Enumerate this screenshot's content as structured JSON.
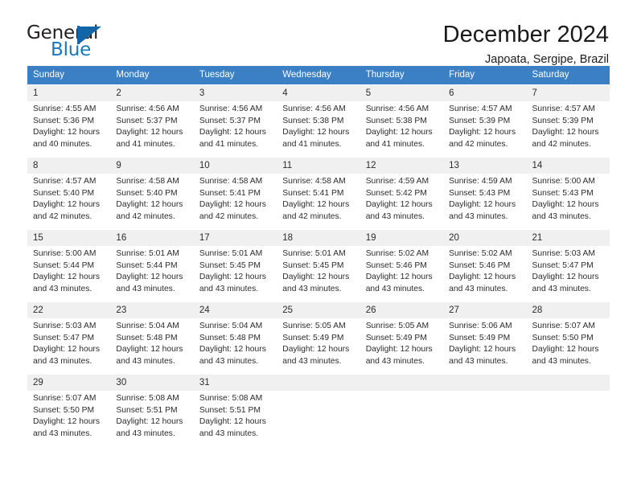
{
  "brand": {
    "name_part1": "General",
    "name_part2": "Blue",
    "sail_icon": "triangle-sail-icon",
    "accent_color": "#1878bd"
  },
  "header": {
    "title": "December 2024",
    "subtitle": "Japoata, Sergipe, Brazil"
  },
  "theme": {
    "header_row_bg": "#3b7fc4",
    "daynum_bg": "#f0f0f0",
    "separator_color": "#4683c6",
    "text_color": "#2b2b2b"
  },
  "weekdays": [
    "Sunday",
    "Monday",
    "Tuesday",
    "Wednesday",
    "Thursday",
    "Friday",
    "Saturday"
  ],
  "labels": {
    "sunrise": "Sunrise:",
    "sunset": "Sunset:",
    "daylight": "Daylight:"
  },
  "weeks": [
    [
      {
        "day": "1",
        "sunrise": "Sunrise: 4:55 AM",
        "sunset": "Sunset: 5:36 PM",
        "daylight_line1": "Daylight: 12 hours",
        "daylight_line2": "and 40 minutes."
      },
      {
        "day": "2",
        "sunrise": "Sunrise: 4:56 AM",
        "sunset": "Sunset: 5:37 PM",
        "daylight_line1": "Daylight: 12 hours",
        "daylight_line2": "and 41 minutes."
      },
      {
        "day": "3",
        "sunrise": "Sunrise: 4:56 AM",
        "sunset": "Sunset: 5:37 PM",
        "daylight_line1": "Daylight: 12 hours",
        "daylight_line2": "and 41 minutes."
      },
      {
        "day": "4",
        "sunrise": "Sunrise: 4:56 AM",
        "sunset": "Sunset: 5:38 PM",
        "daylight_line1": "Daylight: 12 hours",
        "daylight_line2": "and 41 minutes."
      },
      {
        "day": "5",
        "sunrise": "Sunrise: 4:56 AM",
        "sunset": "Sunset: 5:38 PM",
        "daylight_line1": "Daylight: 12 hours",
        "daylight_line2": "and 41 minutes."
      },
      {
        "day": "6",
        "sunrise": "Sunrise: 4:57 AM",
        "sunset": "Sunset: 5:39 PM",
        "daylight_line1": "Daylight: 12 hours",
        "daylight_line2": "and 42 minutes."
      },
      {
        "day": "7",
        "sunrise": "Sunrise: 4:57 AM",
        "sunset": "Sunset: 5:39 PM",
        "daylight_line1": "Daylight: 12 hours",
        "daylight_line2": "and 42 minutes."
      }
    ],
    [
      {
        "day": "8",
        "sunrise": "Sunrise: 4:57 AM",
        "sunset": "Sunset: 5:40 PM",
        "daylight_line1": "Daylight: 12 hours",
        "daylight_line2": "and 42 minutes."
      },
      {
        "day": "9",
        "sunrise": "Sunrise: 4:58 AM",
        "sunset": "Sunset: 5:40 PM",
        "daylight_line1": "Daylight: 12 hours",
        "daylight_line2": "and 42 minutes."
      },
      {
        "day": "10",
        "sunrise": "Sunrise: 4:58 AM",
        "sunset": "Sunset: 5:41 PM",
        "daylight_line1": "Daylight: 12 hours",
        "daylight_line2": "and 42 minutes."
      },
      {
        "day": "11",
        "sunrise": "Sunrise: 4:58 AM",
        "sunset": "Sunset: 5:41 PM",
        "daylight_line1": "Daylight: 12 hours",
        "daylight_line2": "and 42 minutes."
      },
      {
        "day": "12",
        "sunrise": "Sunrise: 4:59 AM",
        "sunset": "Sunset: 5:42 PM",
        "daylight_line1": "Daylight: 12 hours",
        "daylight_line2": "and 43 minutes."
      },
      {
        "day": "13",
        "sunrise": "Sunrise: 4:59 AM",
        "sunset": "Sunset: 5:43 PM",
        "daylight_line1": "Daylight: 12 hours",
        "daylight_line2": "and 43 minutes."
      },
      {
        "day": "14",
        "sunrise": "Sunrise: 5:00 AM",
        "sunset": "Sunset: 5:43 PM",
        "daylight_line1": "Daylight: 12 hours",
        "daylight_line2": "and 43 minutes."
      }
    ],
    [
      {
        "day": "15",
        "sunrise": "Sunrise: 5:00 AM",
        "sunset": "Sunset: 5:44 PM",
        "daylight_line1": "Daylight: 12 hours",
        "daylight_line2": "and 43 minutes."
      },
      {
        "day": "16",
        "sunrise": "Sunrise: 5:01 AM",
        "sunset": "Sunset: 5:44 PM",
        "daylight_line1": "Daylight: 12 hours",
        "daylight_line2": "and 43 minutes."
      },
      {
        "day": "17",
        "sunrise": "Sunrise: 5:01 AM",
        "sunset": "Sunset: 5:45 PM",
        "daylight_line1": "Daylight: 12 hours",
        "daylight_line2": "and 43 minutes."
      },
      {
        "day": "18",
        "sunrise": "Sunrise: 5:01 AM",
        "sunset": "Sunset: 5:45 PM",
        "daylight_line1": "Daylight: 12 hours",
        "daylight_line2": "and 43 minutes."
      },
      {
        "day": "19",
        "sunrise": "Sunrise: 5:02 AM",
        "sunset": "Sunset: 5:46 PM",
        "daylight_line1": "Daylight: 12 hours",
        "daylight_line2": "and 43 minutes."
      },
      {
        "day": "20",
        "sunrise": "Sunrise: 5:02 AM",
        "sunset": "Sunset: 5:46 PM",
        "daylight_line1": "Daylight: 12 hours",
        "daylight_line2": "and 43 minutes."
      },
      {
        "day": "21",
        "sunrise": "Sunrise: 5:03 AM",
        "sunset": "Sunset: 5:47 PM",
        "daylight_line1": "Daylight: 12 hours",
        "daylight_line2": "and 43 minutes."
      }
    ],
    [
      {
        "day": "22",
        "sunrise": "Sunrise: 5:03 AM",
        "sunset": "Sunset: 5:47 PM",
        "daylight_line1": "Daylight: 12 hours",
        "daylight_line2": "and 43 minutes."
      },
      {
        "day": "23",
        "sunrise": "Sunrise: 5:04 AM",
        "sunset": "Sunset: 5:48 PM",
        "daylight_line1": "Daylight: 12 hours",
        "daylight_line2": "and 43 minutes."
      },
      {
        "day": "24",
        "sunrise": "Sunrise: 5:04 AM",
        "sunset": "Sunset: 5:48 PM",
        "daylight_line1": "Daylight: 12 hours",
        "daylight_line2": "and 43 minutes."
      },
      {
        "day": "25",
        "sunrise": "Sunrise: 5:05 AM",
        "sunset": "Sunset: 5:49 PM",
        "daylight_line1": "Daylight: 12 hours",
        "daylight_line2": "and 43 minutes."
      },
      {
        "day": "26",
        "sunrise": "Sunrise: 5:05 AM",
        "sunset": "Sunset: 5:49 PM",
        "daylight_line1": "Daylight: 12 hours",
        "daylight_line2": "and 43 minutes."
      },
      {
        "day": "27",
        "sunrise": "Sunrise: 5:06 AM",
        "sunset": "Sunset: 5:49 PM",
        "daylight_line1": "Daylight: 12 hours",
        "daylight_line2": "and 43 minutes."
      },
      {
        "day": "28",
        "sunrise": "Sunrise: 5:07 AM",
        "sunset": "Sunset: 5:50 PM",
        "daylight_line1": "Daylight: 12 hours",
        "daylight_line2": "and 43 minutes."
      }
    ],
    [
      {
        "day": "29",
        "sunrise": "Sunrise: 5:07 AM",
        "sunset": "Sunset: 5:50 PM",
        "daylight_line1": "Daylight: 12 hours",
        "daylight_line2": "and 43 minutes."
      },
      {
        "day": "30",
        "sunrise": "Sunrise: 5:08 AM",
        "sunset": "Sunset: 5:51 PM",
        "daylight_line1": "Daylight: 12 hours",
        "daylight_line2": "and 43 minutes."
      },
      {
        "day": "31",
        "sunrise": "Sunrise: 5:08 AM",
        "sunset": "Sunset: 5:51 PM",
        "daylight_line1": "Daylight: 12 hours",
        "daylight_line2": "and 43 minutes."
      },
      {
        "day": "",
        "sunrise": "",
        "sunset": "",
        "daylight_line1": "",
        "daylight_line2": "",
        "blank": true
      },
      {
        "day": "",
        "sunrise": "",
        "sunset": "",
        "daylight_line1": "",
        "daylight_line2": "",
        "blank": true
      },
      {
        "day": "",
        "sunrise": "",
        "sunset": "",
        "daylight_line1": "",
        "daylight_line2": "",
        "blank": true
      },
      {
        "day": "",
        "sunrise": "",
        "sunset": "",
        "daylight_line1": "",
        "daylight_line2": "",
        "blank": true
      }
    ]
  ]
}
